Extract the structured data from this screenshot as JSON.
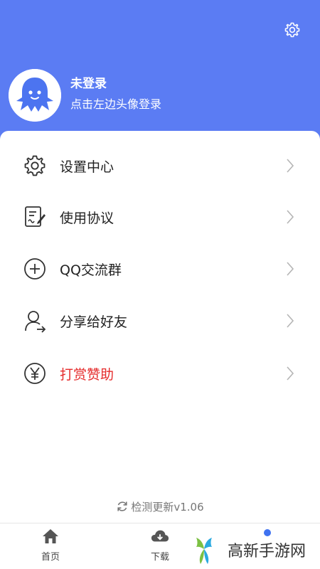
{
  "header": {
    "settings_icon": "gear-icon",
    "avatar_icon": "ghost-avatar-icon",
    "user_title": "未登录",
    "user_subtitle": "点击左边头像登录",
    "bg_color": "#5b7cf3"
  },
  "menu": {
    "items": [
      {
        "icon": "gear-icon",
        "label": "设置中心"
      },
      {
        "icon": "document-edit-icon",
        "label": "使用协议"
      },
      {
        "icon": "plus-circle-icon",
        "label": "QQ交流群"
      },
      {
        "icon": "share-user-icon",
        "label": "分享给好友"
      },
      {
        "icon": "yen-circle-icon",
        "label": "打赏赞助",
        "color": "#e52b2b"
      }
    ]
  },
  "update": {
    "icon": "refresh-icon",
    "label": "检测更新v1.06"
  },
  "tabs": [
    {
      "icon": "home-icon",
      "label": "首页"
    },
    {
      "icon": "cloud-download-icon",
      "label": "下载"
    }
  ],
  "watermark": {
    "text": "高新手游网"
  }
}
